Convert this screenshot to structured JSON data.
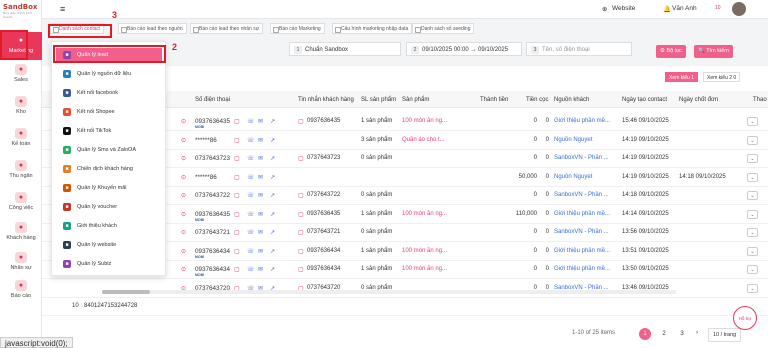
{
  "logo": {
    "name": "SandBox",
    "tagline": "Nhà điều hành kinh doanh"
  },
  "sidebar": [
    {
      "label": "Marketing",
      "icon": "megaphone-icon",
      "active": true
    },
    {
      "label": "Sales",
      "icon": "chart-icon"
    },
    {
      "label": "Kho",
      "icon": "warehouse-icon"
    },
    {
      "label": "Kế toán",
      "icon": "calculator-icon"
    },
    {
      "label": "Thu ngân",
      "icon": "cashier-icon"
    },
    {
      "label": "Công việc",
      "icon": "task-icon"
    },
    {
      "label": "Khách hàng",
      "icon": "customer-icon"
    },
    {
      "label": "Nhân sự",
      "icon": "people-icon"
    },
    {
      "label": "Báo cáo",
      "icon": "report-icon"
    }
  ],
  "topbar": {
    "website": "Website",
    "user": "Văn Anh",
    "notif": "10"
  },
  "tabs": [
    "Danh sách contact",
    "Báo cáo lead theo nguồn",
    "Báo cáo lead theo nhân sự",
    "Báo cáo Marketing",
    "Cấu hình marketing nhập data",
    "Danh sách số seeding"
  ],
  "filters": {
    "num1": "1",
    "store": "Chuẩn Sandbox",
    "num2": "2",
    "range": "09/10/2025 00:00 → 09/10/2025",
    "num3": "3",
    "search_ph": "Tên, số điện thoại",
    "filter_btn": "Bộ lọc",
    "search_btn": "Tìm kiếm"
  },
  "views": {
    "v1": "Xem kiểu 1",
    "v2": "Xem kiểu 2",
    "count": "0"
  },
  "columns": [
    "Số điện thoại",
    "Tin nhắn khách hàng",
    "SL sản phẩm",
    "Sản phẩm",
    "Thành tiền",
    "Tiền cọc",
    "Nguồn khách",
    "Ngày tạo contact",
    "Ngày chốt đơn",
    "Thao tác"
  ],
  "rows": [
    {
      "phone": "0937636435",
      "mobi": "MOBI",
      "msg": "0937636435",
      "qty": "1 sản phẩm",
      "product": "100 món ăn ng...",
      "total": "0",
      "dep": "0",
      "source": "Giới thiệu phần mề...",
      "created": "15:46 09/10/2025",
      "closed": ""
    },
    {
      "phone": "******86",
      "mobi": "",
      "msg": "",
      "qty": "3 sản phẩm",
      "product": "Quần áo cho t...",
      "total": "0",
      "dep": "0",
      "source": "Nguồn Nguyet",
      "created": "14:19 09/10/2025",
      "closed": ""
    },
    {
      "phone": "0737643723",
      "mobi": "",
      "msg": "0737643723",
      "qty": "0 sản phẩm",
      "product": "",
      "total": "0",
      "dep": "0",
      "source": "SanboxVN - Phần ...",
      "created": "14:19 09/10/2025",
      "closed": ""
    },
    {
      "phone": "******86",
      "mobi": "",
      "msg": "",
      "qty": "",
      "product": "",
      "total": "50,000",
      "dep": "0",
      "source": "Nguồn Nguyet",
      "created": "14:19 09/10/2025",
      "closed": "14:18 09/10/2025"
    },
    {
      "phone": "0737643722",
      "mobi": "",
      "msg": "0737643722",
      "qty": "0 sản phẩm",
      "product": "",
      "total": "0",
      "dep": "0",
      "source": "SanboxVN - Phần ...",
      "created": "14:18 09/10/2025",
      "closed": ""
    },
    {
      "phone": "0937636435",
      "mobi": "MOBI",
      "msg": "0937636435",
      "qty": "1 sản phẩm",
      "product": "100 món ăn ng...",
      "total": "110,000",
      "dep": "0",
      "source": "Giới thiệu phần mề...",
      "created": "14:14 09/10/2025",
      "closed": ""
    },
    {
      "phone": "0737643721",
      "mobi": "",
      "msg": "0737643721",
      "qty": "0 sản phẩm",
      "product": "",
      "total": "0",
      "dep": "0",
      "source": "SanboxVN - Phần ...",
      "created": "13:56 09/10/2025",
      "closed": ""
    },
    {
      "phone": "0937636434",
      "mobi": "MOBI",
      "msg": "0937636434",
      "qty": "1 sản phẩm",
      "product": "100 món ăn ng...",
      "total": "0",
      "dep": "0",
      "source": "Giới thiệu phần mề...",
      "created": "13:51 09/10/2025",
      "closed": ""
    },
    {
      "phone": "0937636434",
      "mobi": "MOBI",
      "msg": "0937636434",
      "qty": "1 sản phẩm",
      "product": "100 món ăn ng...",
      "total": "0",
      "dep": "0",
      "source": "Giới thiệu phần mề...",
      "created": "13:50 09/10/2025",
      "closed": ""
    },
    {
      "phone": "0737643720",
      "mobi": "",
      "msg": "0737643720",
      "qty": "0 sản phẩm",
      "product": "",
      "total": "0",
      "dep": "0",
      "source": "SanboxVN - Phần ...",
      "created": "13:46 09/10/2025",
      "closed": ""
    }
  ],
  "lastrow": {
    "idx": "10",
    "id": "8401247153244728"
  },
  "menu": [
    {
      "label": "Quản lý lead",
      "color": "#8e44ad",
      "selected": true
    },
    {
      "label": "Quản lý nguồn dữ liệu",
      "color": "#2980b9"
    },
    {
      "label": "Kết nối facebook",
      "color": "#3b5998"
    },
    {
      "label": "Kết nối Shopee",
      "color": "#ee4d2d"
    },
    {
      "label": "Kết nối TikTok",
      "color": "#111111"
    },
    {
      "label": "Quản lý Sms và ZaloOA",
      "color": "#27ae60"
    },
    {
      "label": "Chiến dịch khách hàng",
      "color": "#e67e22"
    },
    {
      "label": "Quản lý Khuyến mãi",
      "color": "#d35400"
    },
    {
      "label": "Quản lý voucher",
      "color": "#c0392b"
    },
    {
      "label": "Giới thiệu khách",
      "color": "#16a085"
    },
    {
      "label": "Quản lý website",
      "color": "#2c3e50"
    },
    {
      "label": "Quản lý Subiz",
      "color": "#8e44ad"
    }
  ],
  "annotations": {
    "a2": "2",
    "a3": "3"
  },
  "pagination": {
    "info": "1-10 of 25 items",
    "p1": "1",
    "p2": "2",
    "p3": "3",
    "size": "10 / trang"
  },
  "status": "javascript:void(0);",
  "chat": "Hỗ trợ"
}
